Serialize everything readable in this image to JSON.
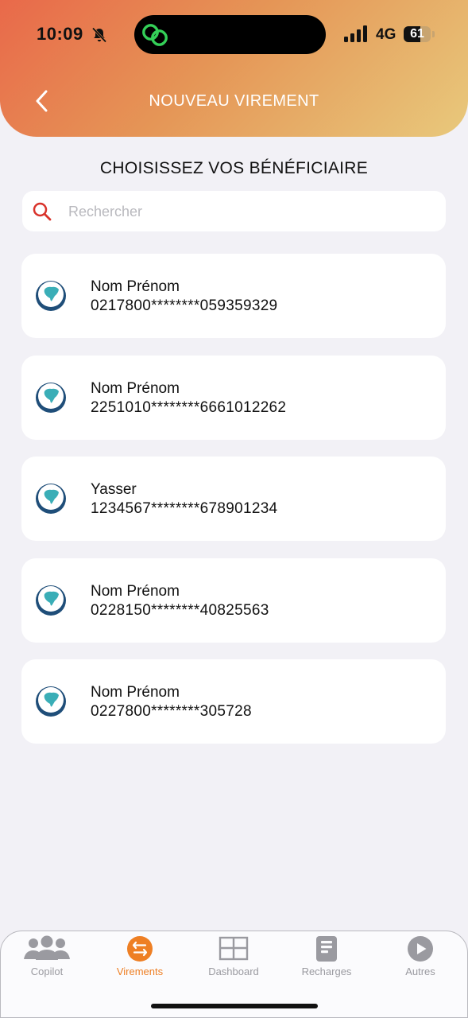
{
  "status_bar": {
    "time": "10:09",
    "network": "4G",
    "battery": "61",
    "battery_level": 0.61
  },
  "header": {
    "title": "NOUVEAU VIREMENT",
    "back_icon": "chevron-left-icon"
  },
  "section_title": "CHOISISSEZ VOS BÉNÉFICIAIRE",
  "search": {
    "placeholder": "Rechercher",
    "value": ""
  },
  "beneficiaries": [
    {
      "name": "Nom Prénom",
      "account": "0217800********059359329"
    },
    {
      "name": "Nom Prénom",
      "account": "2251010********6661012262"
    },
    {
      "name": "Yasser",
      "account": "1234567********678901234"
    },
    {
      "name": "Nom Prénom",
      "account": "0228150********40825563"
    },
    {
      "name": "Nom Prénom",
      "account": "0227800********305728"
    }
  ],
  "tabs": [
    {
      "label": "Copilot",
      "icon": "people-icon",
      "active": false
    },
    {
      "label": "Virements",
      "icon": "transfer-icon",
      "active": true
    },
    {
      "label": "Dashboard",
      "icon": "dashboard-icon",
      "active": false
    },
    {
      "label": "Recharges",
      "icon": "document-icon",
      "active": false
    },
    {
      "label": "Autres",
      "icon": "play-icon",
      "active": false
    }
  ],
  "colors": {
    "accent": "#ee7f24",
    "search_icon": "#d9332b",
    "logo_blue": "#1f4e79",
    "logo_teal": "#3aaeb7"
  }
}
